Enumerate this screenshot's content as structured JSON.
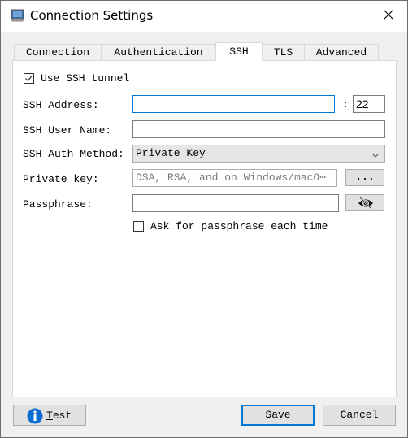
{
  "window": {
    "title": "Connection Settings",
    "icon": "computer-icon",
    "close_icon": "close-icon"
  },
  "tabs": [
    {
      "label": "Connection",
      "active": false
    },
    {
      "label": "Authentication",
      "active": false
    },
    {
      "label": "SSH",
      "active": true
    },
    {
      "label": "TLS",
      "active": false
    },
    {
      "label": "Advanced",
      "active": false
    }
  ],
  "ssh": {
    "use_tunnel": {
      "label": "Use SSH tunnel",
      "checked": true
    },
    "address": {
      "label": "SSH Address:",
      "value": "",
      "separator": ":",
      "port": "22"
    },
    "user_name": {
      "label": "SSH User Name:",
      "value": ""
    },
    "auth_method": {
      "label": "SSH Auth Method:",
      "selected": "Private Key"
    },
    "private_key": {
      "label": "Private key:",
      "placeholder": "DSA, RSA, and on Windows/macO⋯",
      "browse_label": "..."
    },
    "passphrase": {
      "label": "Passphrase:",
      "value": "",
      "toggle_icon": "eye-slash-icon"
    },
    "ask_passphrase": {
      "label": "Ask for passphrase each time",
      "checked": false
    }
  },
  "footer": {
    "test_label": "Test",
    "test_mnemonic": "T",
    "test_rest": "est",
    "test_icon": "info-icon",
    "save_label": "Save",
    "cancel_label": "Cancel"
  },
  "colors": {
    "accent": "#0078d7",
    "info_icon": "#0a6ed1"
  }
}
